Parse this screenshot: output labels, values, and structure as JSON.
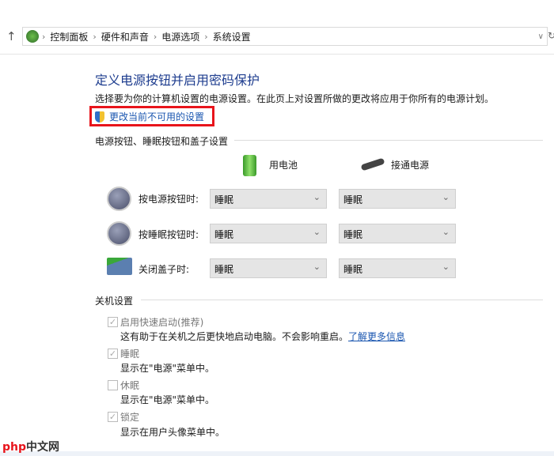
{
  "breadcrumb": [
    "控制面板",
    "硬件和声音",
    "电源选项",
    "系统设置"
  ],
  "title": "定义电源按钮并启用密码保护",
  "description": "选择要为你的计算机设置的电源设置。在此页上对设置所做的更改将应用于你所有的电源计划。",
  "change_link": "更改当前不可用的设置",
  "section1": "电源按钮、睡眠按钮和盖子设置",
  "columns": {
    "battery": "用电池",
    "plugged": "接通电源"
  },
  "rows": [
    {
      "label": "按电源按钮时:",
      "battery": "睡眠",
      "plugged": "睡眠"
    },
    {
      "label": "按睡眠按钮时:",
      "battery": "睡眠",
      "plugged": "睡眠"
    },
    {
      "label": "关闭盖子时:",
      "battery": "睡眠",
      "plugged": "睡眠"
    }
  ],
  "section2": "关机设置",
  "shutdown": [
    {
      "label": "启用快速启动(推荐)",
      "checked": true,
      "desc": "这有助于在关机之后更快地启动电脑。不会影响重启。",
      "link": "了解更多信息"
    },
    {
      "label": "睡眠",
      "checked": true,
      "desc": "显示在\"电源\"菜单中。"
    },
    {
      "label": "休眠",
      "checked": false,
      "desc": "显示在\"电源\"菜单中。"
    },
    {
      "label": "锁定",
      "checked": true,
      "desc": "显示在用户头像菜单中。"
    }
  ],
  "watermark": "php中文网",
  "colors": {
    "title": "#1e3d8f",
    "link": "#0066cc",
    "highlight": "#e8141b"
  }
}
